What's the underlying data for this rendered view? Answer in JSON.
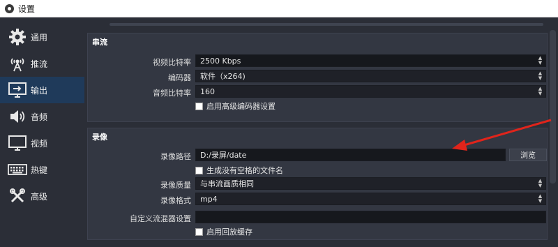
{
  "window": {
    "title": "设置"
  },
  "sidebar": {
    "items": [
      {
        "label": "通用",
        "icon": "gear-icon"
      },
      {
        "label": "推流",
        "icon": "antenna-icon"
      },
      {
        "label": "输出",
        "icon": "monitor-output-icon",
        "active": true
      },
      {
        "label": "音频",
        "icon": "speaker-icon"
      },
      {
        "label": "视频",
        "icon": "monitor-icon"
      },
      {
        "label": "热键",
        "icon": "keyboard-icon"
      },
      {
        "label": "高级",
        "icon": "tools-icon"
      }
    ]
  },
  "streaming": {
    "title": "串流",
    "video_bitrate_label": "视频比特率",
    "video_bitrate_value": "2500 Kbps",
    "encoder_label": "编码器",
    "encoder_value": "软件（x264)",
    "audio_bitrate_label": "音频比特率",
    "audio_bitrate_value": "160",
    "advanced_encoder_label": "启用高级编码器设置"
  },
  "recording": {
    "title": "录像",
    "path_label": "录像路径",
    "path_value": "D:/录屏/date",
    "browse_label": "浏览",
    "no_space_label": "生成没有空格的文件名",
    "quality_label": "录像质量",
    "quality_value": "与串流画质相同",
    "format_label": "录像格式",
    "format_value": "mp4",
    "muxer_label": "自定义流混器设置",
    "muxer_value": "",
    "replay_buffer_label": "启用回放缓存"
  },
  "colors": {
    "background": "#2b2e37",
    "active_nav": "#1f3a5a",
    "annotation_arrow": "#e0241b"
  }
}
